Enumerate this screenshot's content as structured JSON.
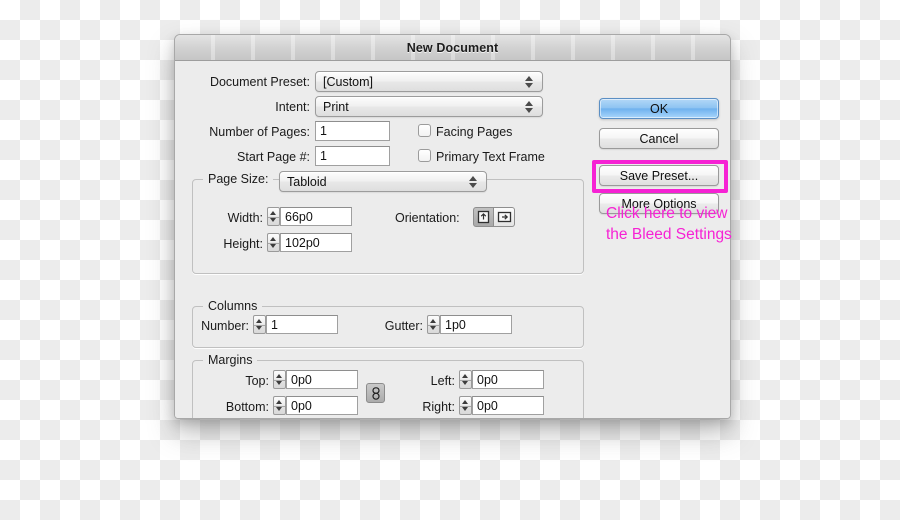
{
  "window": {
    "title": "New Document"
  },
  "fields": {
    "document_preset": {
      "label": "Document Preset:",
      "value": "[Custom]"
    },
    "intent": {
      "label": "Intent:",
      "value": "Print"
    },
    "number_of_pages": {
      "label": "Number of Pages:",
      "value": "1"
    },
    "start_page": {
      "label": "Start Page #:",
      "value": "1"
    }
  },
  "checkboxes": [
    {
      "label": "Facing Pages",
      "checked": false
    },
    {
      "label": "Primary Text Frame",
      "checked": false
    }
  ],
  "page_size": {
    "label": "Page Size:",
    "value": "Tabloid",
    "width": {
      "label": "Width:",
      "value": "66p0"
    },
    "height": {
      "label": "Height:",
      "value": "102p0"
    },
    "orientation": {
      "label": "Orientation:",
      "portrait_icon": "portrait-orientation-icon",
      "landscape_icon": "landscape-orientation-icon",
      "selected": "portrait"
    }
  },
  "columns": {
    "title": "Columns",
    "number": {
      "label": "Number:",
      "value": "1"
    },
    "gutter": {
      "label": "Gutter:",
      "value": "1p0"
    }
  },
  "margins": {
    "title": "Margins",
    "top": {
      "label": "Top:",
      "value": "0p0"
    },
    "bottom": {
      "label": "Bottom:",
      "value": "0p0"
    },
    "left": {
      "label": "Left:",
      "value": "0p0"
    },
    "right": {
      "label": "Right:",
      "value": "0p0"
    },
    "link_icon": "chain-link-icon"
  },
  "buttons": {
    "ok": "OK",
    "cancel": "Cancel",
    "save_preset": "Save Preset...",
    "more_options": "More Options"
  },
  "annotation": {
    "text": "Click here to view the Bleed Settings",
    "color": "#f622d4"
  },
  "colors": {
    "dialog_bg": "#ececec",
    "accent_blue": "#8fc4f2",
    "annotation_pink": "#f622d4",
    "checker_light": "#ffffff",
    "checker_dark": "#ececec"
  }
}
